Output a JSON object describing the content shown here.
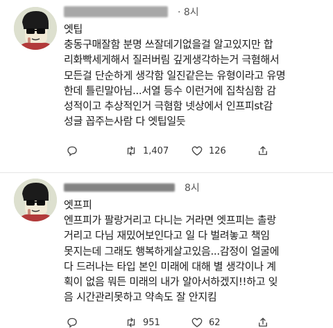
{
  "tweets": [
    {
      "time": "· 8시",
      "lines": [
        "엣팁",
        "충동구매잘함 분명 쓰잘데기없을걸 알고있지만 합",
        "리화빡세게해서 질러버림 깊게생각하는거 극혐해서",
        "모든걸 단순하게 생각함 일진같은는 유형이라고 유명",
        "한데 틀린말아님...서열 등수 이런거에 집착심함 감",
        "성적이고 추상적인거 극혐함 넷상에서 인프피st감",
        "성글 꼽주는사람 다 엣팁일듯"
      ],
      "replies": "",
      "retweets": "1,407",
      "likes": "126"
    },
    {
      "time": "8시",
      "lines": [
        "엣프피",
        "엔프피가 팔랑거리고 다니는 거라면 엣프피는 촐랑",
        "거리고 다님 재밌어보인다고 일 다 벌려놓고 책임",
        "못지는데 그래도 행복하게살고있음...감정이 얼굴에",
        "다 드러나는 타입 본인 미래에 대해 별 생각이나 계",
        "획이 없음 뭐든 미래의 내가 알아서하겠지!!하고 잊",
        "음 시간관리못하고 약속도 잘 안지킴"
      ],
      "replies": "",
      "retweets": "951",
      "likes": "62"
    }
  ]
}
